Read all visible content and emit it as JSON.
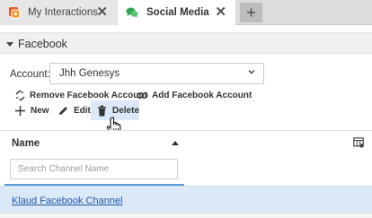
{
  "tabs": [
    {
      "label": "My Interactions",
      "close": "✕",
      "icon": "interactions-icon",
      "icon_color": "#e8572a"
    },
    {
      "label": "Social Media",
      "close": "✕",
      "icon": "chat-bubbles-icon",
      "icon_color": "#2fa84f",
      "active": true
    }
  ],
  "add_tab": "+",
  "panel": {
    "title": "Facebook"
  },
  "account": {
    "label": "Account:",
    "value": "Jhh Genesys"
  },
  "link_actions": {
    "remove": "Remove Facebook Account",
    "add": "Add Facebook Account"
  },
  "toolbar": {
    "new": "New",
    "edit": "Edit",
    "delete": "Delete"
  },
  "grid": {
    "column_name": "Name",
    "search_placeholder": "Search Channel Name",
    "rows": [
      {
        "name": "Klaud Facebook Channel"
      }
    ]
  },
  "colors": {
    "accent": "#5a9ad6",
    "selection": "#dbe8f7",
    "link": "#1f58a8"
  }
}
